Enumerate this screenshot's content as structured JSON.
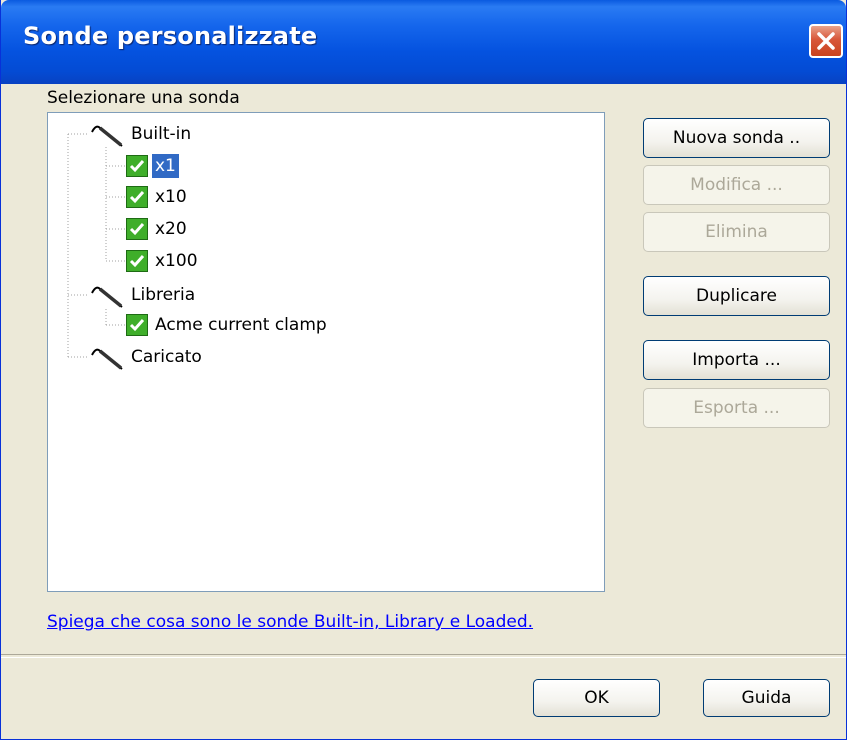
{
  "window": {
    "title": "Sonde personalizzate"
  },
  "tree": {
    "label": "Selezionare una sonda",
    "groups": [
      {
        "label": "Built-in",
        "items": [
          "x1",
          "x10",
          "x20",
          "x100"
        ],
        "selected": "x1"
      },
      {
        "label": "Libreria",
        "items": [
          "Acme current clamp"
        ]
      },
      {
        "label": "Caricato",
        "items": []
      }
    ]
  },
  "buttons": {
    "new_probe": "Nuova sonda ..",
    "edit": "Modifica ...",
    "delete": "Elimina",
    "duplicate": "Duplicare",
    "import": "Importa ...",
    "export": "Esporta ..."
  },
  "help_link": "Spiega che cosa sono le sonde Built-in, Library e Loaded.",
  "footer": {
    "ok": "OK",
    "help": "Guida"
  },
  "colors": {
    "titlebar": "#0553e0",
    "selection": "#316ac5",
    "check_green": "#3fae2a",
    "link": "#0000ff"
  }
}
